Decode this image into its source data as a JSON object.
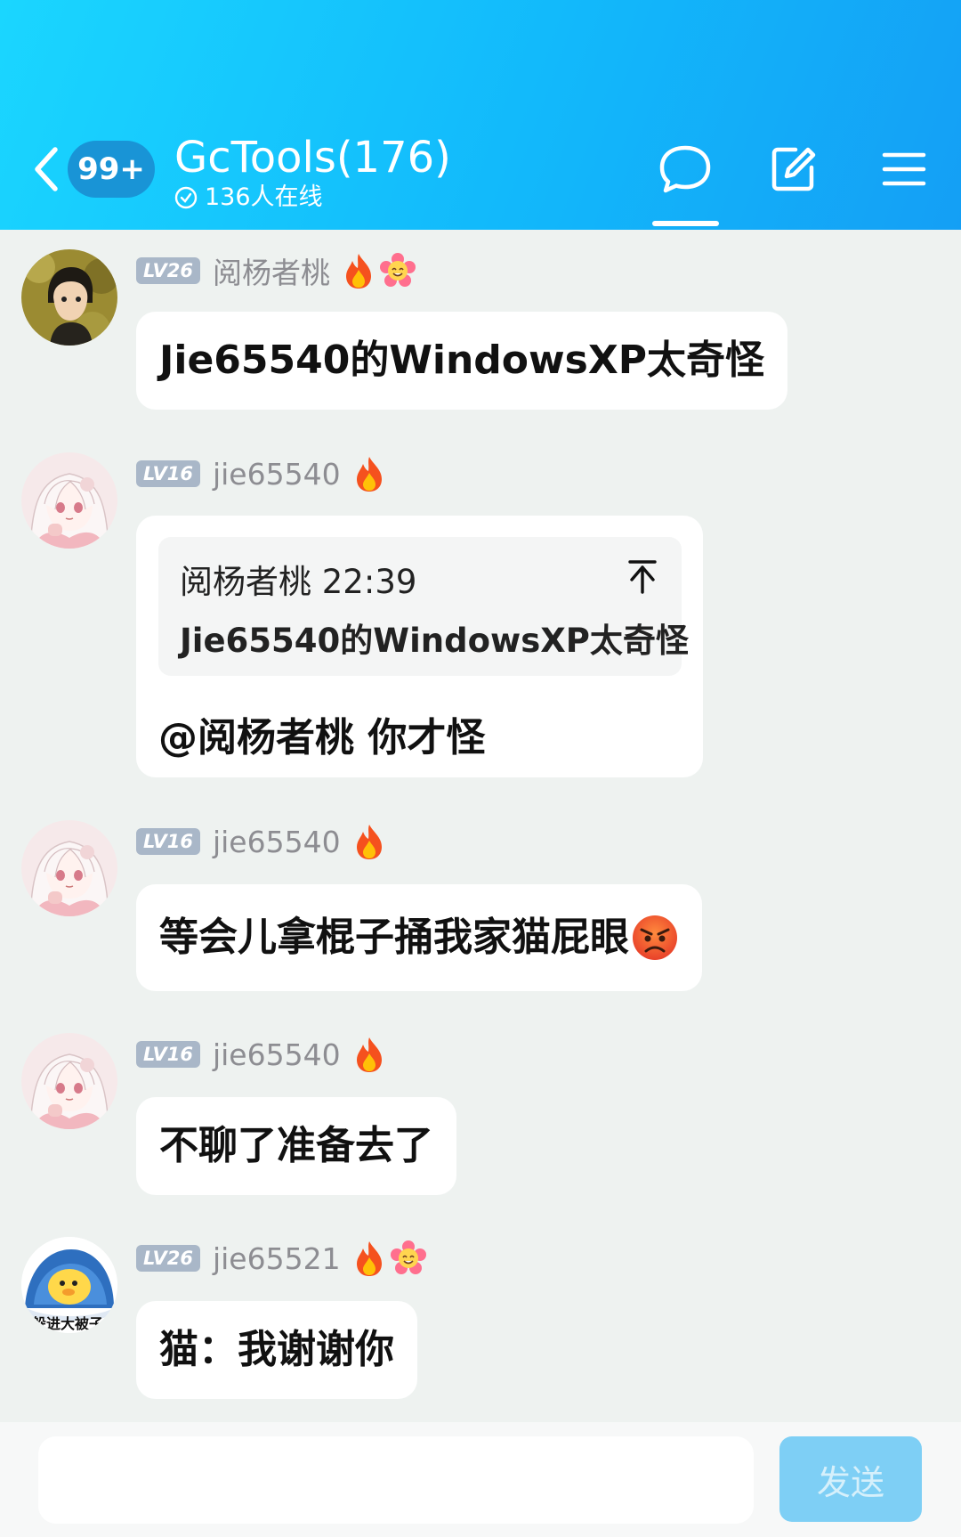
{
  "header": {
    "unread_badge": "99+",
    "title": "GcTools(176)",
    "online": "136人在线",
    "icons": [
      "back-icon",
      "chat-bubble-icon",
      "edit-icon",
      "menu-icon"
    ]
  },
  "messages": [
    {
      "level": "LV26",
      "name": "阅杨者桃",
      "badges": [
        "fire",
        "flower"
      ],
      "text": "Jie65540的WindowsXP太奇怪"
    },
    {
      "level": "LV16",
      "name": "jie65540",
      "badges": [
        "fire"
      ],
      "quote": {
        "author": "阅杨者桃",
        "time": "22:39",
        "text": "Jie65540的WindowsXP太奇怪"
      },
      "text": "@阅杨者桃 你才怪"
    },
    {
      "level": "LV16",
      "name": "jie65540",
      "badges": [
        "fire"
      ],
      "text": "等会儿拿棍子捅我家猫屁眼"
    },
    {
      "level": "LV16",
      "name": "jie65540",
      "badges": [
        "fire"
      ],
      "text": "不聊了准备去了"
    },
    {
      "level": "LV26",
      "name": "jie65521",
      "badges": [
        "fire",
        "flower"
      ],
      "text": "猫：我谢谢你",
      "avatar_caption": "躲进大被子"
    }
  ],
  "input": {
    "placeholder": "",
    "send_label": "发送"
  },
  "colors": {
    "header_start": "#1ad6ff",
    "header_end": "#149ff5",
    "send_button": "#7ecff5",
    "level_badge": "#a9b7c8"
  }
}
